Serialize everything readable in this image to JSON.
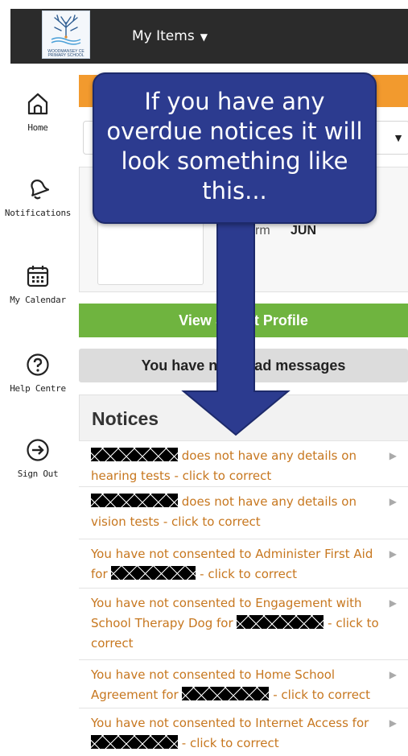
{
  "header": {
    "logo_line1": "WOODMANSEY CE",
    "logo_line2": "PRIMARY SCHOOL",
    "menu_label": "My Items"
  },
  "sidebar": {
    "items": [
      {
        "label": "Home",
        "icon": "home-icon"
      },
      {
        "label": "Notifications",
        "icon": "bell-icon"
      },
      {
        "label": "My Calendar",
        "icon": "calendar-icon"
      },
      {
        "label": "Help Centre",
        "icon": "question-icon"
      },
      {
        "label": "Sign Out",
        "icon": "sign-out-icon"
      }
    ]
  },
  "student": {
    "form_label": "rm",
    "form_value": "JUN"
  },
  "buttons": {
    "view_profile": "View S     nt Profile",
    "messages": "You have no     ead messages"
  },
  "callout": {
    "text": "If you have any overdue notices it will look something like this..."
  },
  "notices": {
    "title": "Notices",
    "items": [
      {
        "before": "",
        "after": " does not have any details on hearing tests - click to correct"
      },
      {
        "before": "",
        "after": " does not have any details on vision tests - click to correct"
      },
      {
        "before": "You have not consented to Administer First Aid for ",
        "after": " - click to correct"
      },
      {
        "before": "You have not consented to Engagement with School Therapy Dog for ",
        "after": " - click to correct"
      },
      {
        "before": "You have not consented to Home School Agreement for ",
        "after": " - click to correct"
      },
      {
        "before": "You have not consented to Internet Access for ",
        "after": " - click to correct"
      }
    ]
  },
  "colors": {
    "topbar": "#2b2b2b",
    "orange": "#f29a2e",
    "green": "#6fb43f",
    "notice_link": "#c7771f",
    "callout": "#2c3b8f"
  }
}
